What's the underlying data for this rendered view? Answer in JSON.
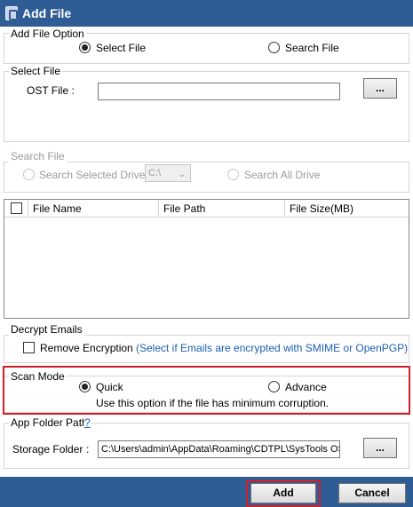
{
  "window": {
    "title": "Add File"
  },
  "add_file_option": {
    "legend": "Add File Option",
    "select_file_label": "Select File",
    "search_file_label": "Search File",
    "selected": "Select File"
  },
  "select_file": {
    "legend": "Select File",
    "ost_label": "OST File :",
    "ost_value": "",
    "browse_label": "..."
  },
  "search_file": {
    "legend": "Search File",
    "search_selected_drive_label": "Search Selected Drive",
    "drive_value": "C:\\",
    "search_all_drive_label": "Search All Drive"
  },
  "file_list": {
    "columns": [
      "File Name",
      "File Path",
      "File Size(MB)"
    ],
    "rows": []
  },
  "decrypt_emails": {
    "legend": "Decrypt Emails",
    "remove_encryption_label": "Remove Encryption",
    "hint": "(Select if Emails are encrypted with SMIME or OpenPGP)"
  },
  "scan_mode": {
    "legend": "Scan Mode",
    "quick_label": "Quick",
    "advance_label": "Advance",
    "selected": "Quick",
    "description": "Use this option if the file has minimum corruption."
  },
  "app_folder": {
    "legend": "App Folder Path",
    "help_label": "?",
    "storage_label": "Storage Folder",
    "colon": ":",
    "storage_value": "C:\\Users\\admin\\AppData\\Roaming\\CDTPL\\SysTools OST",
    "browse_label": "..."
  },
  "actions": {
    "add_label": "Add",
    "cancel_label": "Cancel"
  },
  "colors": {
    "title_bar": "#2f5c95",
    "highlight": "#d0202a",
    "link": "#1a5fb4"
  }
}
